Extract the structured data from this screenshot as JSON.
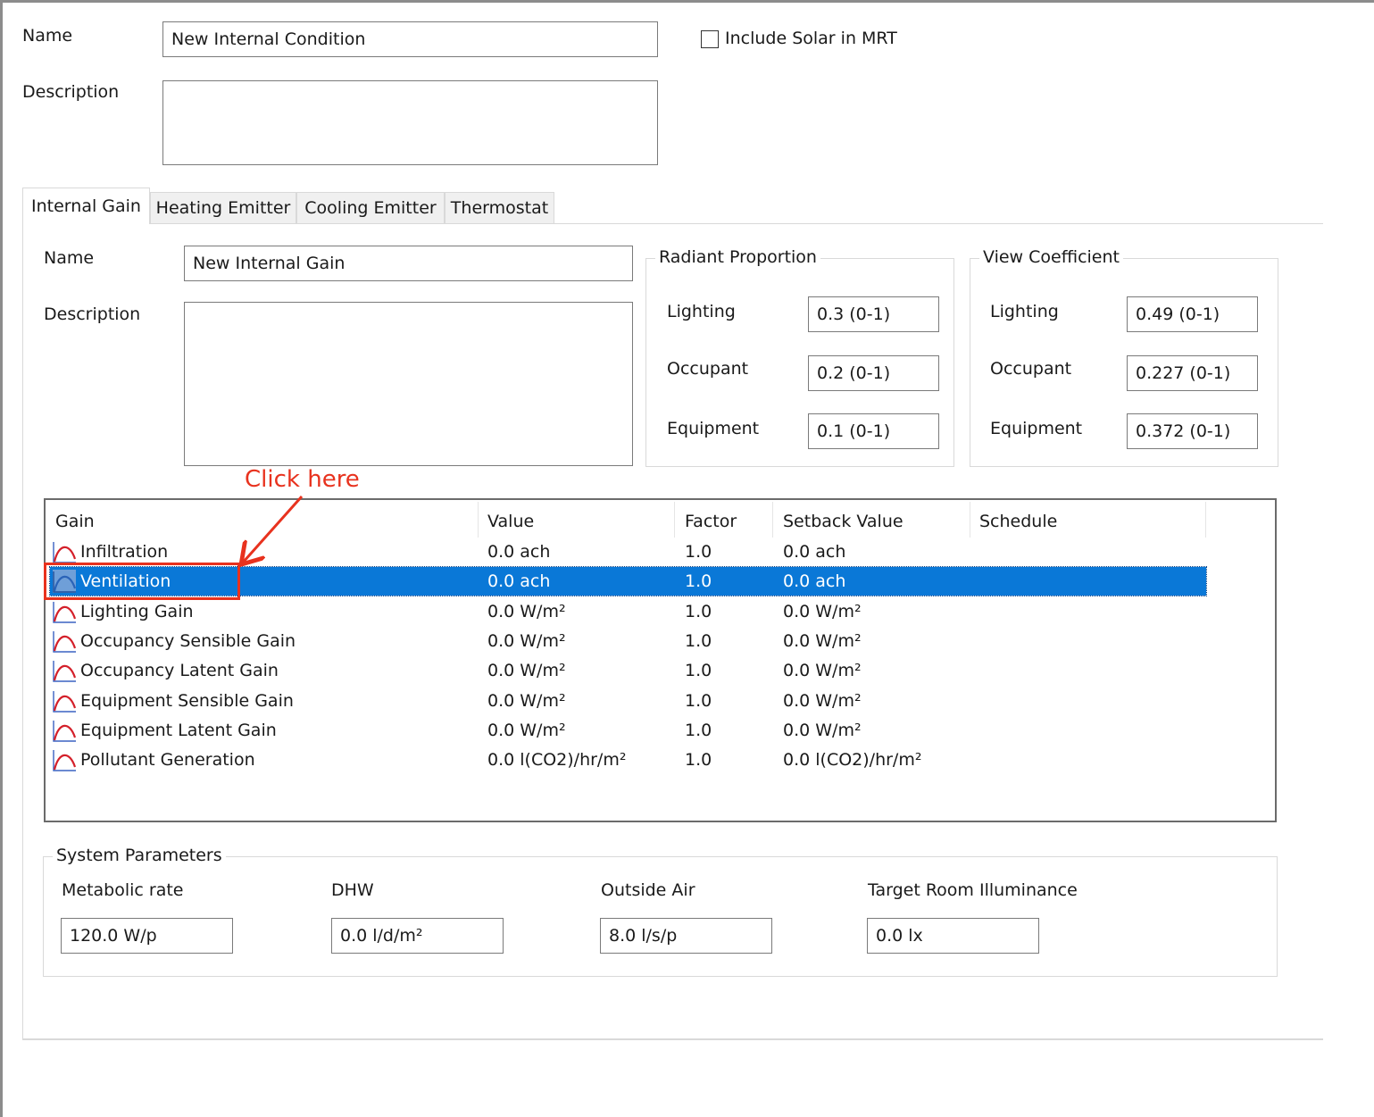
{
  "condition": {
    "name_label": "Name",
    "name_value": "New Internal Condition",
    "description_label": "Description",
    "description_value": "",
    "include_solar_label": "Include Solar in MRT",
    "include_solar_checked": false
  },
  "tabs": [
    {
      "label": "Internal Gain",
      "active": true
    },
    {
      "label": "Heating Emitter",
      "active": false
    },
    {
      "label": "Cooling Emitter",
      "active": false
    },
    {
      "label": "Thermostat",
      "active": false
    }
  ],
  "gain": {
    "name_label": "Name",
    "name_value": "New Internal Gain",
    "description_label": "Description",
    "description_value": ""
  },
  "radiant_proportion": {
    "title": "Radiant Proportion",
    "lighting_label": "Lighting",
    "lighting_value": "0.3 (0-1)",
    "occupant_label": "Occupant",
    "occupant_value": "0.2 (0-1)",
    "equipment_label": "Equipment",
    "equipment_value": "0.1 (0-1)"
  },
  "view_coefficient": {
    "title": "View Coefficient",
    "lighting_label": "Lighting",
    "lighting_value": "0.49 (0-1)",
    "occupant_label": "Occupant",
    "occupant_value": "0.227 (0-1)",
    "equipment_label": "Equipment",
    "equipment_value": "0.372 (0-1)"
  },
  "gain_table": {
    "columns": [
      "Gain",
      "Value",
      "Factor",
      "Setback Value",
      "Schedule"
    ],
    "rows": [
      {
        "gain": "Infiltration",
        "value": "0.0 ach",
        "factor": "1.0",
        "setback": "0.0 ach",
        "schedule": "",
        "selected": false
      },
      {
        "gain": "Ventilation",
        "value": "0.0 ach",
        "factor": "1.0",
        "setback": "0.0 ach",
        "schedule": "",
        "selected": true
      },
      {
        "gain": "Lighting Gain",
        "value": "0.0 W/m²",
        "factor": "1.0",
        "setback": "0.0 W/m²",
        "schedule": "",
        "selected": false
      },
      {
        "gain": "Occupancy Sensible Gain",
        "value": "0.0 W/m²",
        "factor": "1.0",
        "setback": "0.0 W/m²",
        "schedule": "",
        "selected": false
      },
      {
        "gain": "Occupancy Latent Gain",
        "value": "0.0 W/m²",
        "factor": "1.0",
        "setback": "0.0 W/m²",
        "schedule": "",
        "selected": false
      },
      {
        "gain": "Equipment Sensible Gain",
        "value": "0.0 W/m²",
        "factor": "1.0",
        "setback": "0.0 W/m²",
        "schedule": "",
        "selected": false
      },
      {
        "gain": "Equipment Latent Gain",
        "value": "0.0 W/m²",
        "factor": "1.0",
        "setback": "0.0 W/m²",
        "schedule": "",
        "selected": false
      },
      {
        "gain": "Pollutant Generation",
        "value": "0.0 l(CO2)/hr/m²",
        "factor": "1.0",
        "setback": "0.0 l(CO2)/hr/m²",
        "schedule": "",
        "selected": false
      }
    ]
  },
  "system_parameters": {
    "title": "System Parameters",
    "metabolic_label": "Metabolic rate",
    "metabolic_value": "120.0 W/p",
    "dhw_label": "DHW",
    "dhw_value": "0.0 l/d/m²",
    "outside_air_label": "Outside Air",
    "outside_air_value": "8.0 l/s/p",
    "illuminance_label": "Target Room Illuminance",
    "illuminance_value": "0.0 lx"
  },
  "annotation": {
    "text": "Click here",
    "color": "#e8321e"
  },
  "colors": {
    "selection": "#0a78d7",
    "curve_icon": "#d4202a",
    "curve_icon_selected": "#2a63b8"
  }
}
